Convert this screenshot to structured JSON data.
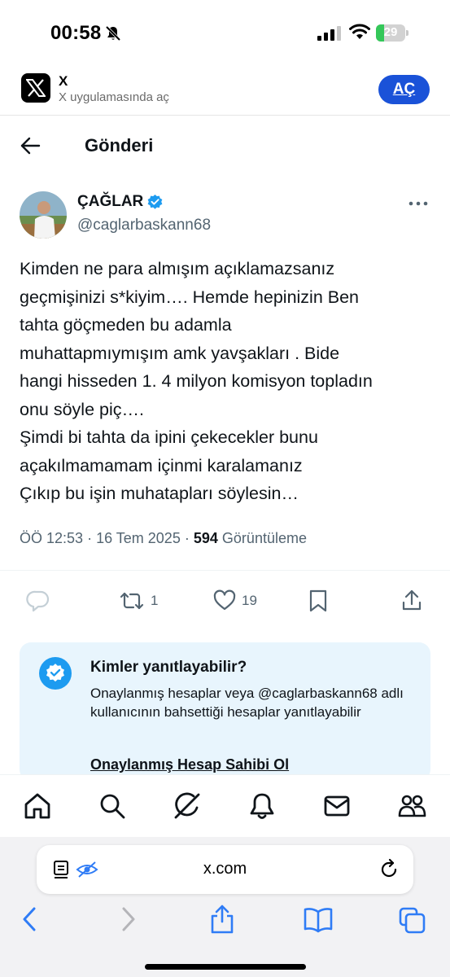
{
  "status_bar": {
    "time": "00:58",
    "battery_level": "29",
    "battery_percent": 29
  },
  "app_banner": {
    "app_name": "X",
    "subtitle": "X uygulamasında aç",
    "open_label": "AÇ"
  },
  "header": {
    "title": "Gönderi"
  },
  "post": {
    "author_name": "ÇAĞLAR",
    "author_handle": "@caglarbaskann68",
    "text": "Kimden ne para almışım açıklamazsanız\ngeçmişinizi s*kiyim…. Hemde hepinizin Ben\ntahta göçmeden bu adamla\nmuhattapmıymışım amk yavşakları . Bide\nhangi hisseden 1. 4 milyon komisyon topladın\nonu söyle piç….\nŞimdi bi tahta da ipini çekecekler bunu\naçakılmamamam içinmi karalamanız\nÇıkıp bu işin muhatapları söylesin…",
    "time": "ÖÖ 12:53",
    "separator": "·",
    "date": "16 Tem 2025",
    "views_count": "594",
    "views_label": "Görüntüleme"
  },
  "actions": {
    "reposts": "1",
    "likes": "19"
  },
  "reply_card": {
    "title": "Kimler yanıtlayabilir?",
    "body": "Onaylanmış hesaplar veya @caglarbaskann68 adlı kullanıcının bahsettiği hesaplar yanıtlayabilir",
    "link": "Onaylanmış Hesap Sahibi Ol"
  },
  "safari": {
    "url": "x.com"
  },
  "colors": {
    "accent_blue": "#1d9bf0",
    "open_button_blue": "#1a52d8",
    "secondary_text": "#536471",
    "card_background": "#e8f5fd",
    "safari_blue": "#2f7cf6"
  }
}
